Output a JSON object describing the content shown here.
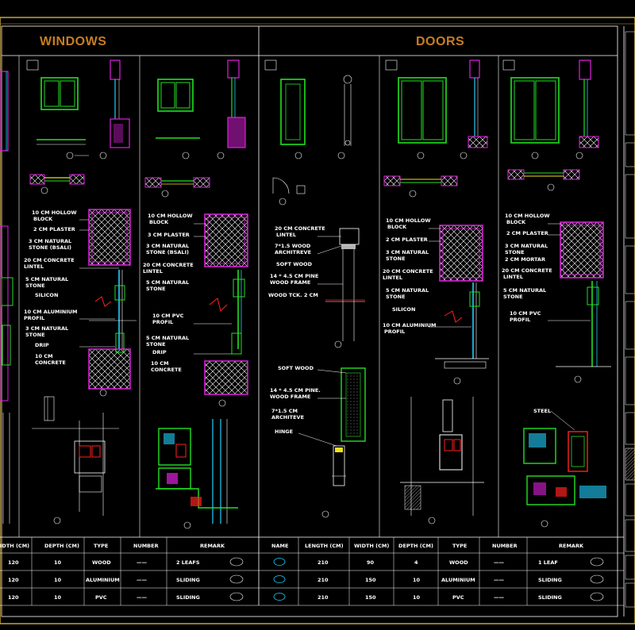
{
  "sections": {
    "windows": "WINDOWS",
    "doors": "DOORS"
  },
  "windows_col1_notes": [
    "10 CM HOLLOW",
    "BLOCK",
    "2 CM PLASTER",
    "3 CM NATURAL",
    "STONE (BSALI)",
    "20 CM CONCRETE",
    "LINTEL",
    "5 CM NATURAL",
    "STONE",
    "SILICON",
    "10 CM ALUMINIUM",
    "PROFIL",
    "3 CM NATURAL",
    "STONE",
    "DRIP",
    "10 CM",
    "CONCRETE"
  ],
  "windows_col2_notes": [
    "10 CM HOLLOW",
    "BLOCK",
    "3 CM PLASTER",
    "3 CM NATURAL",
    "STONE (BSALI)",
    "20 CM CONCRETE",
    "LINTEL",
    "5 CM NATURAL",
    "STONE",
    "10 CM PVC",
    "PROFIL",
    "5 CM NATURAL",
    "STONE",
    "DRIP",
    "10 CM",
    "CONCRETE"
  ],
  "doors_col1_notes": [
    "20 CM CONCRETE",
    "LINTEL",
    "7*1.5 WOOD",
    "ARCHITREVE",
    "SOFT WOOD",
    "14 * 4.5 CM PINE",
    "WOOD FRAME",
    "WOOD TCK. 2 CM",
    "SOFT WOOD",
    "14 * 4.5 CM PINE.",
    "WOOD FRAME",
    "7*1.5 CM",
    "ARCHITEVE",
    "HINGE"
  ],
  "doors_col2_notes": [
    "10 CM HOLLOW",
    "BLOCK",
    "2 CM PLASTER",
    "3 CM NATURAL",
    "STONE",
    "20 CM CONCRETE",
    "LINTEL",
    "5 CM NATURAL",
    "STONE",
    "SILICON",
    "10 CM ALUMINIUM",
    "PROFIL"
  ],
  "doors_col3_notes": [
    "10 CM HOLLOW",
    "BLOCK",
    "2 CM PLASTER",
    "3 CM NATURAL",
    "STONE",
    "2 CM MORTAR",
    "20 CM CONCRETE",
    "LINTEL",
    "5 CM NATURAL",
    "STONE",
    "10 CM PVC",
    "PROFIL",
    "STEEL"
  ],
  "windows_table": {
    "headers": [
      "IDTH (CM)",
      "DEPTH (CM)",
      "TYPE",
      "NUMBER",
      "REMARK"
    ],
    "rows": [
      [
        "120",
        "10",
        "WOOD",
        "——",
        "2 LEAFS"
      ],
      [
        "120",
        "10",
        "ALUMINIUM",
        "——",
        "SLIDING"
      ],
      [
        "120",
        "10",
        "PVC",
        "——",
        "SLIDING"
      ]
    ]
  },
  "doors_table": {
    "headers": [
      "NAME",
      "LENGTH (CM)",
      "WIDTH (CM)",
      "DEPTH (CM)",
      "TYPE",
      "NUMBER",
      "REMARK"
    ],
    "rows": [
      [
        "210",
        "90",
        "4",
        "WOOD",
        "——",
        "1 LEAF"
      ],
      [
        "210",
        "150",
        "10",
        "ALUMINIUM",
        "——",
        "SLIDING"
      ],
      [
        "210",
        "150",
        "10",
        "PVC",
        "——",
        "SLIDING"
      ]
    ]
  },
  "colors": {
    "frame": "#ffffff",
    "border_gold": "#c8a23a",
    "green": "#22e022",
    "magenta": "#e020e0",
    "cyan": "#20d0ff",
    "red": "#ff2020",
    "yellow": "#f0e020",
    "orange": "#c87d22"
  }
}
